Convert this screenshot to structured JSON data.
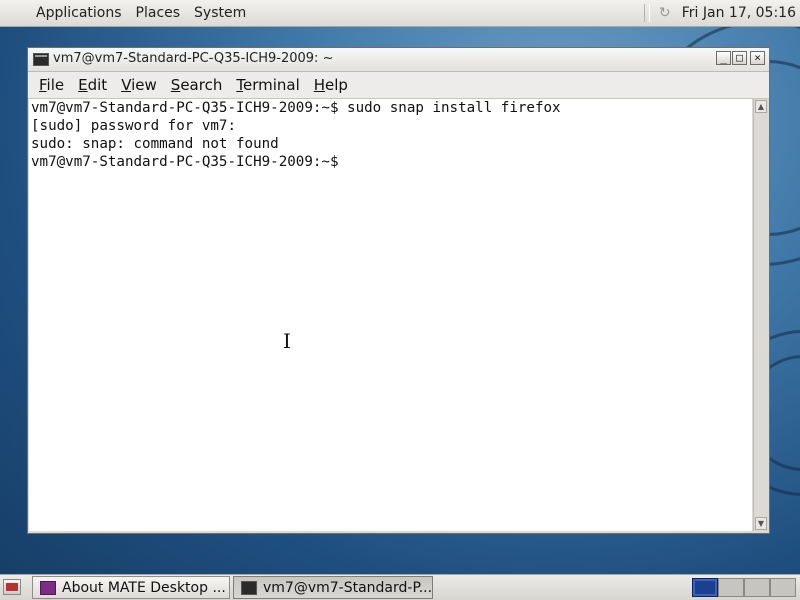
{
  "top_panel": {
    "menus": [
      "Applications",
      "Places",
      "System"
    ],
    "clock": "Fri Jan 17, 05:16"
  },
  "window": {
    "title": "vm7@vm7-Standard-PC-Q35-ICH9-2009: ~",
    "buttons": {
      "minimize": "_",
      "maximize": "□",
      "close": "×"
    },
    "menu": [
      {
        "label": "File",
        "mnemonic": "F",
        "rest": "ile"
      },
      {
        "label": "Edit",
        "mnemonic": "E",
        "rest": "dit"
      },
      {
        "label": "View",
        "mnemonic": "V",
        "rest": "iew"
      },
      {
        "label": "Search",
        "mnemonic": "S",
        "rest": "earch"
      },
      {
        "label": "Terminal",
        "mnemonic": "T",
        "rest": "erminal"
      },
      {
        "label": "Help",
        "mnemonic": "H",
        "rest": "elp"
      }
    ],
    "terminal_lines": [
      "vm7@vm7-Standard-PC-Q35-ICH9-2009:~$ sudo snap install firefox",
      "[sudo] password for vm7:",
      "sudo: snap: command not found",
      "vm7@vm7-Standard-PC-Q35-ICH9-2009:~$"
    ]
  },
  "taskbar": {
    "tasks": [
      {
        "label": "About MATE Desktop ...",
        "icon": "mate-about-icon"
      },
      {
        "label": "vm7@vm7-Standard-P...",
        "icon": "terminal-icon"
      }
    ],
    "workspaces": 4,
    "active_workspace": 1
  },
  "colors": {
    "accent_workspace": "#1d3f8f",
    "desktop_bg": "#3f78a8"
  }
}
